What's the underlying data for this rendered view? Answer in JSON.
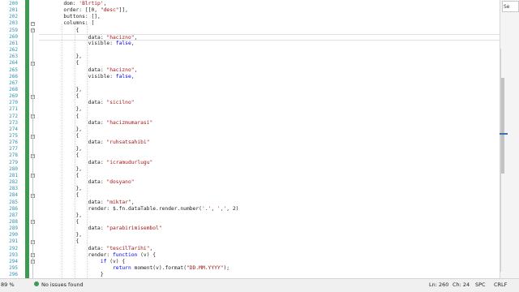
{
  "editor": {
    "lines": [
      {
        "n": "200",
        "text": "        dom: 'Blrtip',",
        "ind": 8
      },
      {
        "n": "201",
        "text": "        order: [[0, \"desc\"]],",
        "ind": 8
      },
      {
        "n": "202",
        "text": "        buttons: [],",
        "ind": 8
      },
      {
        "n": "203",
        "text": "        columns: [",
        "ind": 8
      },
      {
        "n": "259",
        "text": "            {",
        "ind": 12
      },
      {
        "n": "260",
        "text": "                data: \"hacizno\",",
        "ind": 16,
        "active": true
      },
      {
        "n": "261",
        "text": "                visible: false,",
        "ind": 16
      },
      {
        "n": "262",
        "text": "",
        "ind": 0
      },
      {
        "n": "263",
        "text": "            },",
        "ind": 12
      },
      {
        "n": "264",
        "text": "            {",
        "ind": 12
      },
      {
        "n": "265",
        "text": "                data: \"hacizno\",",
        "ind": 16
      },
      {
        "n": "266",
        "text": "                visible: false,",
        "ind": 16
      },
      {
        "n": "267",
        "text": "",
        "ind": 0
      },
      {
        "n": "268",
        "text": "            },",
        "ind": 12
      },
      {
        "n": "269",
        "text": "            {",
        "ind": 12
      },
      {
        "n": "270",
        "text": "                data: \"sicilno\"",
        "ind": 16
      },
      {
        "n": "271",
        "text": "            },",
        "ind": 12
      },
      {
        "n": "272",
        "text": "            {",
        "ind": 12
      },
      {
        "n": "273",
        "text": "                data: \"hacizmumarasi\"",
        "ind": 16
      },
      {
        "n": "274",
        "text": "            },",
        "ind": 12
      },
      {
        "n": "275",
        "text": "            {",
        "ind": 12
      },
      {
        "n": "276",
        "text": "                data: \"ruhsatsahibi\"",
        "ind": 16
      },
      {
        "n": "277",
        "text": "            },",
        "ind": 12
      },
      {
        "n": "278",
        "text": "            {",
        "ind": 12
      },
      {
        "n": "279",
        "text": "                data: \"icramudurlugu\"",
        "ind": 16
      },
      {
        "n": "280",
        "text": "            },",
        "ind": 12
      },
      {
        "n": "281",
        "text": "            {",
        "ind": 12
      },
      {
        "n": "282",
        "text": "                data: \"dosyano\"",
        "ind": 16
      },
      {
        "n": "283",
        "text": "            },",
        "ind": 12
      },
      {
        "n": "284",
        "text": "            {",
        "ind": 12
      },
      {
        "n": "285",
        "text": "                data: \"miktar\",",
        "ind": 16
      },
      {
        "n": "286",
        "text": "                render: $.fn.dataTable.render.number('.', ',', 2)",
        "ind": 16
      },
      {
        "n": "287",
        "text": "            },",
        "ind": 12
      },
      {
        "n": "288",
        "text": "            {",
        "ind": 12
      },
      {
        "n": "289",
        "text": "                data: \"parabirimisembol\"",
        "ind": 16
      },
      {
        "n": "290",
        "text": "            },",
        "ind": 12
      },
      {
        "n": "291",
        "text": "            {",
        "ind": 12
      },
      {
        "n": "292",
        "text": "                data: \"tescilTarihi\",",
        "ind": 16
      },
      {
        "n": "293",
        "text": "                render: function (v) {",
        "ind": 16
      },
      {
        "n": "294",
        "text": "                    if (v) {",
        "ind": 20
      },
      {
        "n": "295",
        "text": "                        return moment(v).format(\"DD.MM.YYYY\");",
        "ind": 24
      },
      {
        "n": "296",
        "text": "                    }",
        "ind": 20
      }
    ]
  },
  "right_panel": {
    "tab_label": "Se"
  },
  "status": {
    "zoom": "89 %",
    "issues": "No issues found",
    "line": "Ln: 260",
    "col": "Ch: 24",
    "spc": "SPC",
    "eol": "CRLF"
  },
  "colors": {
    "line_number": "#2b91af",
    "string": "#a31515",
    "change_indicator": "#3c9a52",
    "statusbar_bg": "#f0f0f0"
  }
}
